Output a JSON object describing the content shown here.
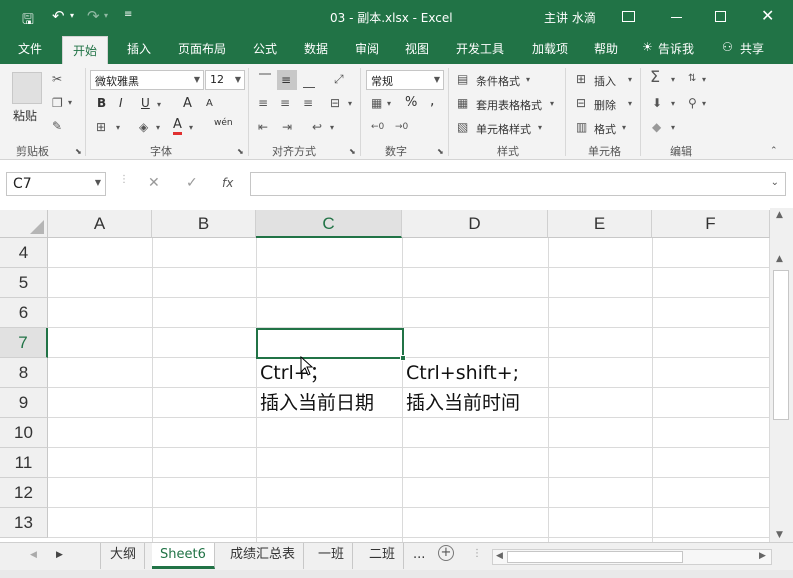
{
  "titlebar": {
    "save_icon": "save-icon",
    "undo_icon": "undo-icon",
    "redo_icon": "redo-icon",
    "customize_icon": "customize-quick-access-icon",
    "title": "03 - 副本.xlsx - Excel",
    "user": "主讲 水滴",
    "ribbon_options_icon": "ribbon-display-options-icon",
    "minimize_icon": "minimize-icon",
    "restore_icon": "restore-icon",
    "close_icon": "close-icon"
  },
  "tabs": [
    "文件",
    "开始",
    "插入",
    "页面布局",
    "公式",
    "数据",
    "审阅",
    "视图",
    "开发工具",
    "加载项",
    "帮助"
  ],
  "active_tab": "开始",
  "tellme": "告诉我",
  "share": "共享",
  "ribbon": {
    "clipboard": {
      "paste": "粘贴",
      "label": "剪贴板"
    },
    "font": {
      "name": "微软雅黑",
      "size": "12",
      "bold": "B",
      "italic": "I",
      "underline": "U",
      "grow": "A",
      "shrink": "A",
      "font_color_letter": "A",
      "phonetic": "wén",
      "label": "字体"
    },
    "alignment": {
      "label": "对齐方式"
    },
    "number": {
      "format": "常规",
      "label": "数字",
      "percent": "%",
      "comma": ","
    },
    "styles": {
      "conditional": "条件格式",
      "table": "套用表格格式",
      "cell": "单元格样式",
      "label": "样式"
    },
    "cells": {
      "insert": "插入",
      "delete": "删除",
      "format": "格式",
      "label": "单元格"
    },
    "editing": {
      "label": "编辑"
    }
  },
  "formula": {
    "namebox": "C7",
    "cancel": "✕",
    "enter": "✓",
    "fx": "fx",
    "value": ""
  },
  "columns": [
    "A",
    "B",
    "C",
    "D",
    "E",
    "F"
  ],
  "selected_column": "C",
  "rows": [
    "4",
    "5",
    "6",
    "7",
    "8",
    "9",
    "10",
    "11",
    "12",
    "13"
  ],
  "selected_row": "7",
  "cells": {
    "C8": "Ctrl+；",
    "D8": "Ctrl+shift+;",
    "C9": "插入当前日期",
    "D9": "插入当前时间"
  },
  "sheets": [
    "大纲",
    "Sheet6",
    "成绩汇总表",
    "一班",
    "二班",
    "..."
  ],
  "active_sheet": "Sheet6"
}
